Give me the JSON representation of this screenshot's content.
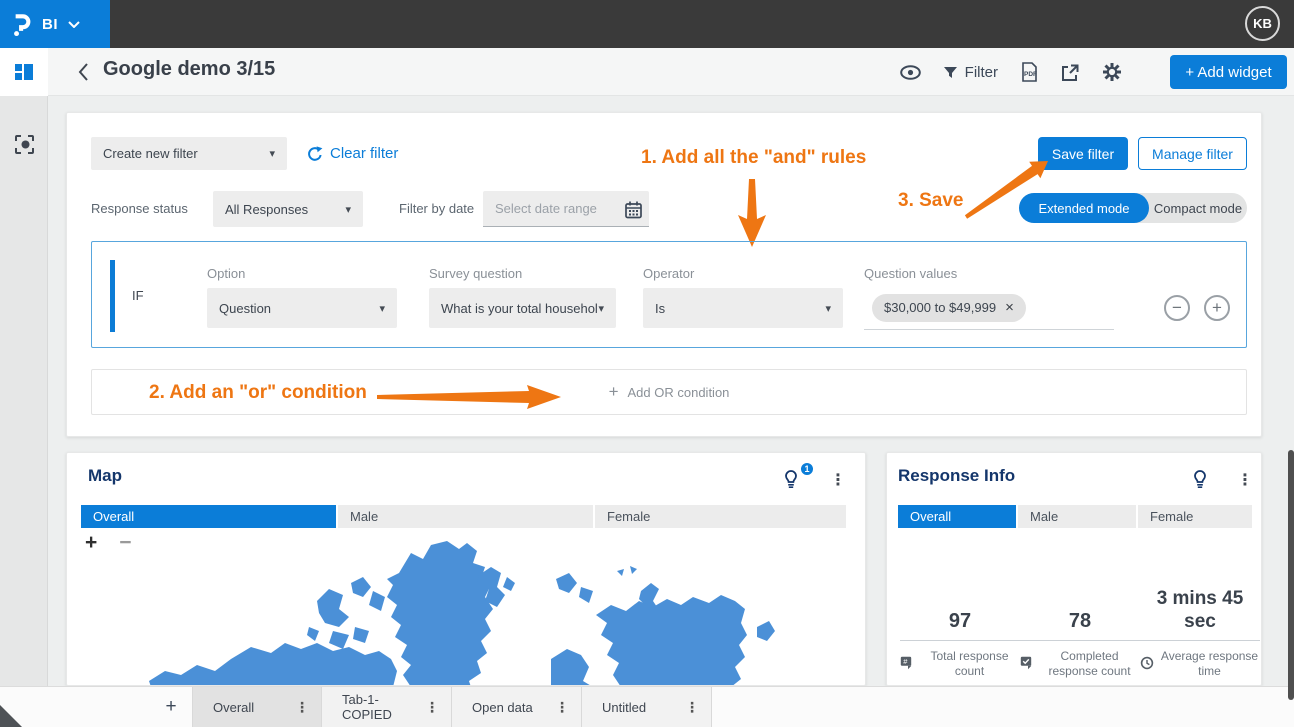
{
  "topbar": {
    "product": "BI",
    "avatar_initials": "KB"
  },
  "header": {
    "title": "Google demo 3/15",
    "filter_label": "Filter",
    "add_widget": "+ Add widget"
  },
  "filter_panel": {
    "create_filter": "Create new filter",
    "clear_filter": "Clear filter",
    "save_filter": "Save filter",
    "manage_filter": "Manage filter",
    "response_status_label": "Response status",
    "response_status_value": "All Responses",
    "filter_by_date_label": "Filter by date",
    "date_placeholder": "Select date range",
    "extended_mode": "Extended mode",
    "compact_mode": "Compact mode",
    "if_label": "IF",
    "columns": [
      {
        "label": "Option",
        "value": "Question"
      },
      {
        "label": "Survey question",
        "value": "What is your total househol"
      },
      {
        "label": "Operator",
        "value": "Is"
      },
      {
        "label": "Question values"
      }
    ],
    "value_tag": "$30,000 to $49,999",
    "add_or_condition": "Add OR condition"
  },
  "annotations": {
    "step1": "1. Add all the \"and\" rules",
    "step2": "2. Add an \"or\" condition",
    "step3": "3. Save"
  },
  "map_widget": {
    "title": "Map",
    "insight_badge": "1",
    "tabs": [
      "Overall",
      "Male",
      "Female"
    ]
  },
  "response_widget": {
    "title": "Response Info",
    "tabs": [
      "Overall",
      "Male",
      "Female"
    ],
    "stats": [
      {
        "value": "97",
        "label": "Total response count"
      },
      {
        "value": "78",
        "label": "Completed response count"
      },
      {
        "value": "3 mins 45 sec",
        "label": "Average response time"
      }
    ]
  },
  "bottom_bar": {
    "tabs": [
      "Overall",
      "Tab-1-COPIED",
      "Open data",
      "Untitled"
    ]
  },
  "icons": {
    "chevron_down": "▾",
    "kebab": "⋮",
    "close": "×",
    "plus": "+",
    "minus": "−",
    "zoom_in": "+",
    "zoom_out": "−"
  },
  "colors": {
    "accent": "#0b7dd8",
    "annotation_orange": "#ee7613",
    "map_fill": "#4b90d7",
    "title_navy": "#14366b",
    "topbar_bg": "#3a3a3a"
  }
}
